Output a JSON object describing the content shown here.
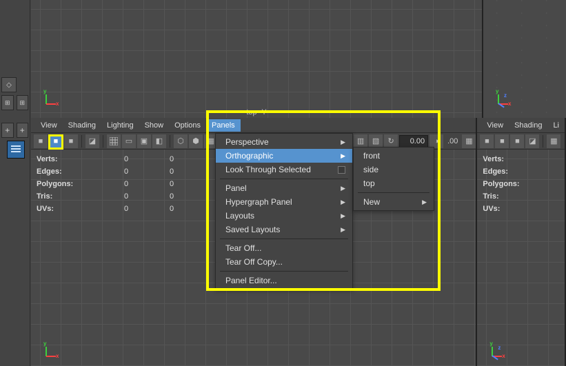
{
  "topViewport": {
    "label": "top -Y"
  },
  "leftPanel": {
    "menu": [
      "View",
      "Shading",
      "Lighting",
      "Show",
      "Options",
      "Panels"
    ],
    "activeMenu": "Panels",
    "toolbarValue": "0.00",
    "extraValue": ".00",
    "hud": {
      "verts": "Verts:",
      "edges": "Edges:",
      "polygons": "Polygons:",
      "tris": "Tris:",
      "uvs": "UVs:"
    },
    "hudValues": {
      "vertsA": "0",
      "vertsB": "0",
      "edgesA": "0",
      "edgesB": "0",
      "polygonsA": "0",
      "polygonsB": "0",
      "trisA": "0",
      "trisB": "0",
      "uvsA": "0",
      "uvsB": "0"
    }
  },
  "rightPanel": {
    "menu": [
      "View",
      "Shading",
      "Li"
    ],
    "hud": {
      "verts": "Verts:",
      "edges": "Edges:",
      "polygons": "Polygons:",
      "tris": "Tris:",
      "uvs": "UVs:"
    }
  },
  "panelsMenu": {
    "perspective": "Perspective",
    "orthographic": "Orthographic",
    "lookThroughSelected": "Look Through Selected",
    "panel": "Panel",
    "hypergraphPanel": "Hypergraph Panel",
    "layouts": "Layouts",
    "savedLayouts": "Saved Layouts",
    "tearOff": "Tear Off...",
    "tearOffCopy": "Tear Off Copy...",
    "panelEditor": "Panel Editor..."
  },
  "orthoSubmenu": {
    "front": "front",
    "side": "side",
    "top": "top",
    "new": "New"
  }
}
